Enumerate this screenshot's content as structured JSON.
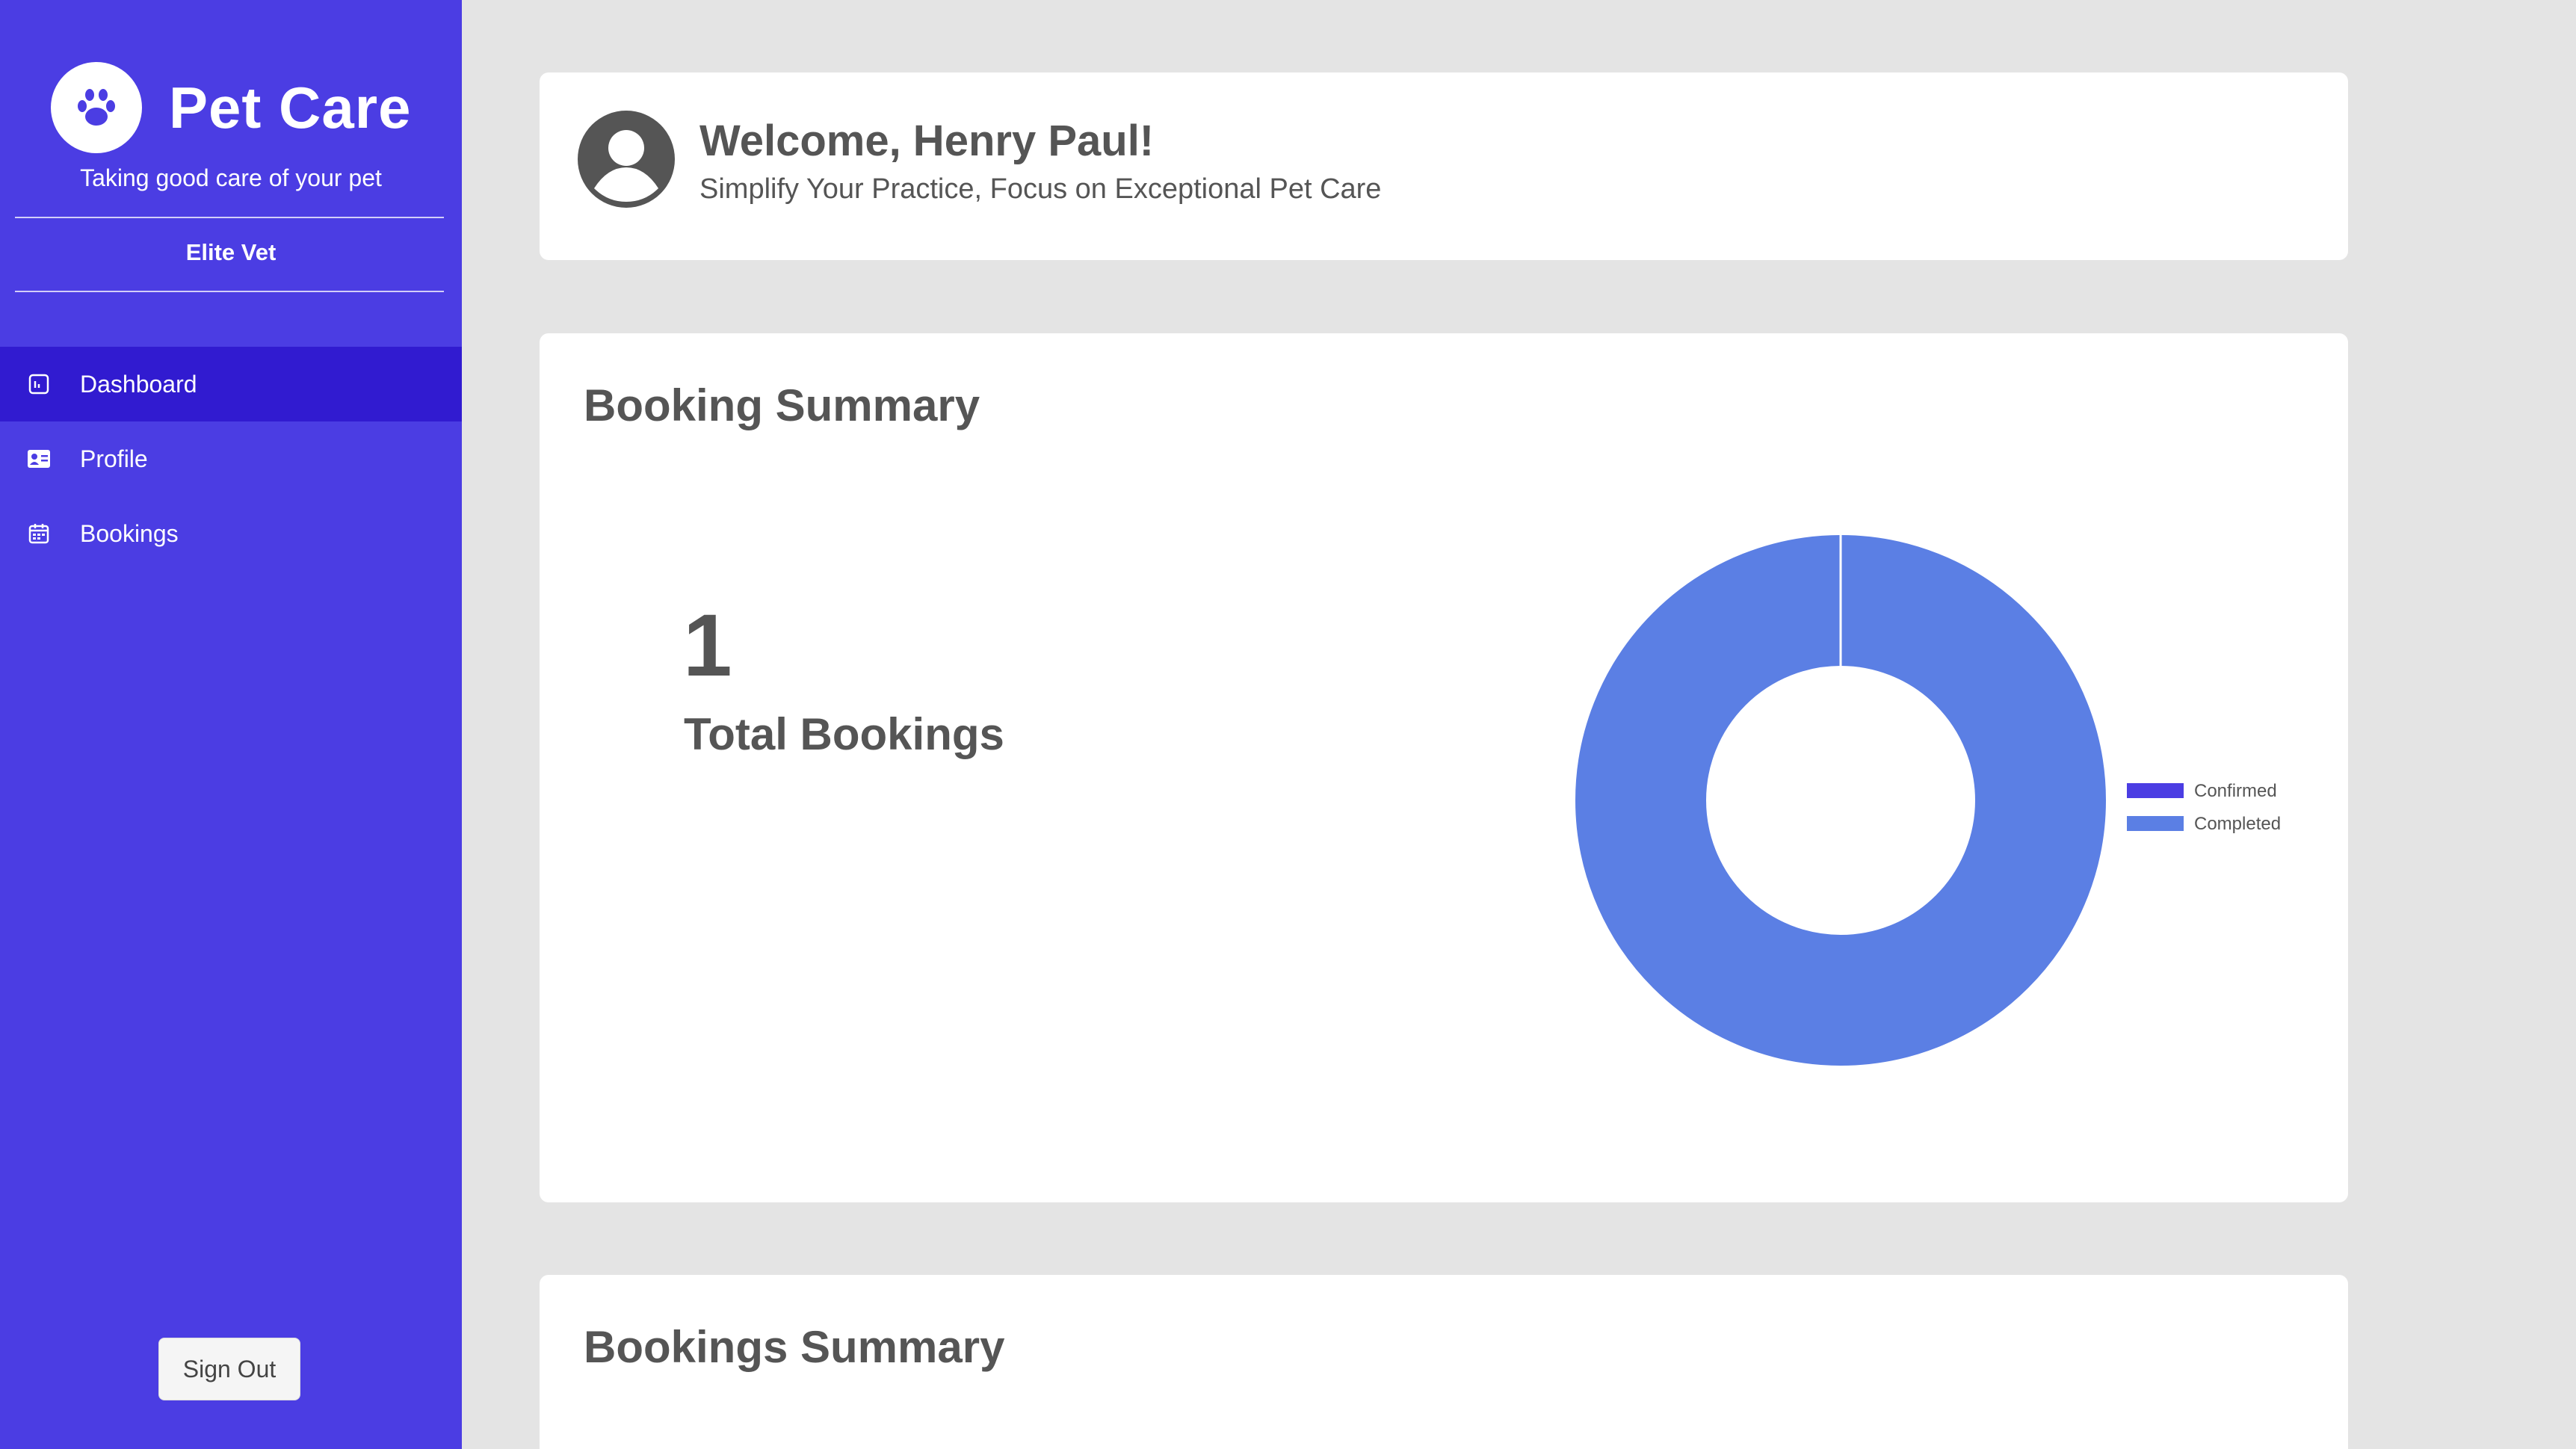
{
  "sidebar": {
    "brand_name": "Pet Care",
    "tagline": "Taking good care of your pet",
    "clinic_name": "Elite Vet",
    "nav": [
      {
        "label": "Dashboard",
        "icon": "dashboard-icon",
        "active": true
      },
      {
        "label": "Profile",
        "icon": "id-card-icon",
        "active": false
      },
      {
        "label": "Bookings",
        "icon": "calendar-icon",
        "active": false
      }
    ],
    "signout_label": "Sign Out"
  },
  "welcome": {
    "title": "Welcome, Henry Paul!",
    "subtitle": "Simplify Your Practice, Focus on Exceptional Pet Care"
  },
  "booking_summary": {
    "title": "Booking Summary",
    "total": "1",
    "total_label": "Total Bookings"
  },
  "bookings_summary": {
    "title": "Bookings Summary"
  },
  "colors": {
    "sidebar": "#4b3de3",
    "active_nav": "#311bd0",
    "confirmed": "#4b3de3",
    "completed": "#5b7fe4"
  },
  "chart_data": {
    "type": "pie",
    "donut": true,
    "labels": [
      "Confirmed",
      "Completed"
    ],
    "values": [
      0,
      1
    ],
    "colors": [
      "#4b3de3",
      "#5b7fe4"
    ],
    "legend_position": "right"
  }
}
